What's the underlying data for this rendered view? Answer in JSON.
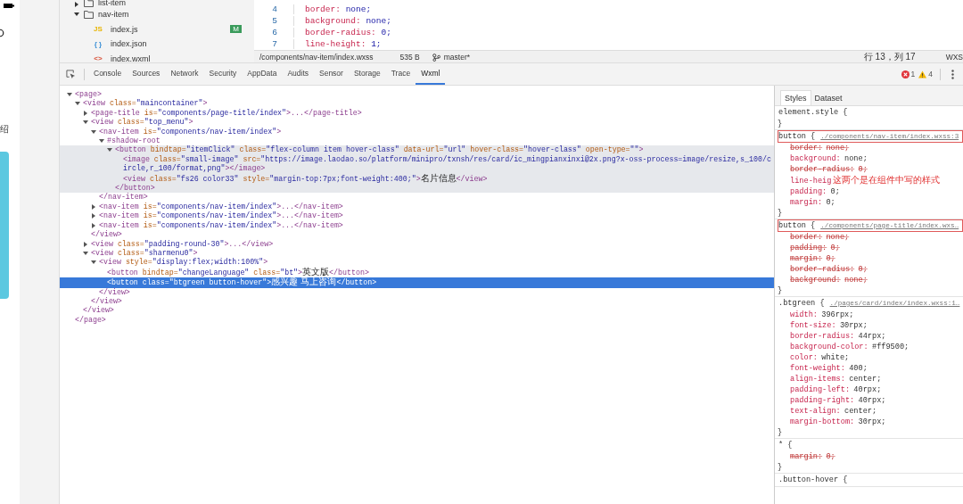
{
  "simulator": {
    "side_text": "绍"
  },
  "file_tree": [
    {
      "name": "list-item",
      "kind": "folder",
      "expanded": false
    },
    {
      "name": "nav-item",
      "kind": "folder",
      "expanded": true,
      "children": [
        {
          "name": "index.js",
          "kind": "js",
          "icon": "JS",
          "badge": "M"
        },
        {
          "name": "index.json",
          "kind": "json",
          "icon": "{ }"
        },
        {
          "name": "index.wxml",
          "kind": "wxml",
          "icon": "<>"
        }
      ]
    }
  ],
  "editor": {
    "lines": [
      {
        "number": "4",
        "prop": "border:",
        "value": "none;"
      },
      {
        "number": "5",
        "prop": "background:",
        "value": "none;"
      },
      {
        "number": "6",
        "prop": "border-radius:",
        "value": "0;"
      },
      {
        "number": "7",
        "prop": "line-height:",
        "value": "1;"
      }
    ]
  },
  "status_bar": {
    "path": "/components/nav-item/index.wxss",
    "size": "535 B",
    "branch": "master*",
    "position": "行 13，列 17",
    "language": "WXS"
  },
  "devtools": {
    "tabs": [
      {
        "label": "Console",
        "selected": false
      },
      {
        "label": "Sources",
        "selected": false
      },
      {
        "label": "Network",
        "selected": false
      },
      {
        "label": "Security",
        "selected": false
      },
      {
        "label": "AppData",
        "selected": false
      },
      {
        "label": "Audits",
        "selected": false
      },
      {
        "label": "Sensor",
        "selected": false
      },
      {
        "label": "Storage",
        "selected": false
      },
      {
        "label": "Trace",
        "selected": false
      },
      {
        "label": "Wxml",
        "selected": true
      }
    ],
    "errors": "1",
    "warnings": "4"
  },
  "wxml": [
    {
      "kind": "branch",
      "tag": "<page",
      "end": ">",
      "expanded": true,
      "selected": false,
      "hovered": false,
      "close": "</page>",
      "children": [
        {
          "kind": "branch",
          "tag": "<view",
          "attrs": [
            {
              "name": "class=",
              "value": "\"maincontainer\""
            }
          ],
          "end": ">",
          "expanded": true,
          "selected": false,
          "hovered": false,
          "close": "</view>",
          "children": [
            {
              "kind": "branch",
              "tag": "<page-title",
              "attrs": [
                {
                  "name": "is=",
                  "value": "\"components/page-title/index\""
                }
              ],
              "end": ">...</page-title>",
              "expanded": false,
              "selected": false,
              "hovered": false
            },
            {
              "kind": "branch",
              "tag": "<view",
              "attrs": [
                {
                  "name": "class=",
                  "value": "\"top_menu\""
                }
              ],
              "end": ">",
              "expanded": true,
              "selected": false,
              "hovered": false,
              "close": "</view>",
              "children": [
                {
                  "kind": "branch",
                  "tag": "<nav-item",
                  "attrs": [
                    {
                      "name": "is=",
                      "value": "\"components/nav-item/index\""
                    }
                  ],
                  "end": ">",
                  "expanded": true,
                  "selected": false,
                  "hovered": false,
                  "close": "</nav-item>",
                  "children": [
                    {
                      "kind": "branch",
                      "tag": "#shadow-root",
                      "expanded": true,
                      "selected": false,
                      "hovered": false,
                      "children": [
                        {
                          "kind": "branch",
                          "tag": "<button",
                          "attrs": [
                            {
                              "name": "bindtap=",
                              "value": "\"itemClick\""
                            },
                            {
                              "name": "class=",
                              "value": "\"flex-column item hover-class\""
                            },
                            {
                              "name": "data-url=",
                              "value": "\"url\""
                            },
                            {
                              "name": "hover-class=",
                              "value": "\"hover-class\""
                            },
                            {
                              "name": "open-type=",
                              "value": "\"\""
                            }
                          ],
                          "end": ">",
                          "expanded": true,
                          "selected": false,
                          "hovered": true,
                          "close": "</button>",
                          "children": [
                            {
                              "kind": "leaf",
                              "tag": "<image",
                              "attrs": [
                                {
                                  "name": "class=",
                                  "value": "\"small-image\""
                                },
                                {
                                  "name": "src=",
                                  "value": "\"https://image.laodao.so/platform/minipro/txnsh/res/card/ic_mingpianxinxi@2x.png?x-oss-process=image/resize,s_100/circle,r_100/format,png\""
                                }
                              ],
                              "end": "></image>",
                              "selected": false,
                              "hovered": true
                            },
                            {
                              "kind": "leaf",
                              "tag": "<view",
                              "attrs": [
                                {
                                  "name": "class=",
                                  "value": "\"fs26 color33\""
                                },
                                {
                                  "name": "style=",
                                  "value": "\"margin-top:7px;font-weight:400;\""
                                }
                              ],
                              "end": ">",
                              "text": "名片信息",
                              "close": "</view>",
                              "selected": false,
                              "hovered": true
                            }
                          ]
                        }
                      ]
                    }
                  ]
                },
                {
                  "kind": "branch",
                  "tag": "<nav-item",
                  "attrs": [
                    {
                      "name": "is=",
                      "value": "\"components/nav-item/index\""
                    }
                  ],
                  "end": ">...</nav-item>",
                  "expanded": false,
                  "selected": false,
                  "hovered": false
                },
                {
                  "kind": "branch",
                  "tag": "<nav-item",
                  "attrs": [
                    {
                      "name": "is=",
                      "value": "\"components/nav-item/index\""
                    }
                  ],
                  "end": ">...</nav-item>",
                  "expanded": false,
                  "selected": false,
                  "hovered": false
                },
                {
                  "kind": "branch",
                  "tag": "<nav-item",
                  "attrs": [
                    {
                      "name": "is=",
                      "value": "\"components/nav-item/index\""
                    }
                  ],
                  "end": ">...</nav-item>",
                  "expanded": false,
                  "selected": false,
                  "hovered": false
                }
              ]
            },
            {
              "kind": "branch",
              "tag": "<view",
              "attrs": [
                {
                  "name": "class=",
                  "value": "\"padding-round-30\""
                }
              ],
              "end": ">...</view>",
              "expanded": false,
              "selected": false,
              "hovered": false
            },
            {
              "kind": "branch",
              "tag": "<view",
              "attrs": [
                {
                  "name": "class=",
                  "value": "\"sharmenu0\""
                }
              ],
              "end": ">",
              "expanded": true,
              "selected": false,
              "hovered": false,
              "close": "</view>",
              "children": [
                {
                  "kind": "branch",
                  "tag": "<view",
                  "attrs": [
                    {
                      "name": "style=",
                      "value": "\"display:flex;width:100%\""
                    }
                  ],
                  "end": ">",
                  "expanded": true,
                  "selected": false,
                  "hovered": false,
                  "close": "</view>",
                  "children": [
                    {
                      "kind": "leaf",
                      "tag": "<button",
                      "attrs": [
                        {
                          "name": "bindtap=",
                          "value": "\"changeLanguage\""
                        },
                        {
                          "name": "class=",
                          "value": "\"bt\""
                        }
                      ],
                      "end": ">",
                      "text": "英文版",
                      "close": "</button>",
                      "selected": false,
                      "hovered": false
                    },
                    {
                      "kind": "leaf",
                      "tag": "<button",
                      "attrs": [
                        {
                          "name": "class=",
                          "value": "\"btgreen button-hover\""
                        }
                      ],
                      "end": ">",
                      "text": "感兴趣 马上咨询",
                      "close": "</button>",
                      "selected": true,
                      "hovered": false
                    }
                  ]
                }
              ]
            }
          ]
        }
      ]
    }
  ],
  "styles": {
    "tabs": [
      {
        "label": "Styles",
        "selected": true
      },
      {
        "label": "Dataset",
        "selected": false
      }
    ],
    "rules": [
      {
        "selector": "element.style {",
        "close": "}",
        "boxed": false
      },
      {
        "selector": "button {",
        "source": "./components/nav-item/index.wxss:3",
        "boxed": true,
        "close": "}",
        "declarations": [
          {
            "prop": "border:",
            "value": "none;",
            "struck": true
          },
          {
            "prop": "background:",
            "value": "none;",
            "struck": false
          },
          {
            "prop": "border-radius:",
            "value": "0;",
            "struck": true
          },
          {
            "prop": "line-heig",
            "note": "这两个是在组件中写的样式",
            "struck": false
          },
          {
            "prop": "padding:",
            "value": "0;",
            "struck": false
          },
          {
            "prop": "margin:",
            "value": "0;",
            "struck": false
          }
        ]
      },
      {
        "selector": "button {",
        "source": "./components/page-title/index.wxs…",
        "boxed": true,
        "close": "}",
        "declarations": [
          {
            "prop": "border:",
            "value": "none;",
            "struck": true
          },
          {
            "prop": "padding:",
            "value": "0;",
            "struck": true
          },
          {
            "prop": "margin:",
            "value": "0;",
            "struck": true
          },
          {
            "prop": "border-radius:",
            "value": "0;",
            "struck": true
          },
          {
            "prop": "background:",
            "value": "none;",
            "struck": true
          }
        ]
      },
      {
        "selector": ".btgreen {",
        "source": "./pages/card/index/index.wxss:1…",
        "boxed": false,
        "close": "}",
        "declarations": [
          {
            "prop": "width:",
            "value": "396rpx;",
            "struck": false
          },
          {
            "prop": "font-size:",
            "value": "30rpx;",
            "struck": false
          },
          {
            "prop": "border-radius:",
            "value": "44rpx;",
            "struck": false
          },
          {
            "prop": "background-color:",
            "value": "#ff9500;",
            "struck": false
          },
          {
            "prop": "color:",
            "value": "white;",
            "struck": false
          },
          {
            "prop": "font-weight:",
            "value": "400;",
            "struck": false
          },
          {
            "prop": "align-items:",
            "value": "center;",
            "struck": false
          },
          {
            "prop": "padding-left:",
            "value": "40rpx;",
            "struck": false
          },
          {
            "prop": "padding-right:",
            "value": "40rpx;",
            "struck": false
          },
          {
            "prop": "text-align:",
            "value": "center;",
            "struck": false
          },
          {
            "prop": "margin-bottom:",
            "value": "30rpx;",
            "struck": false
          }
        ]
      },
      {
        "selector": "* {",
        "boxed": false,
        "close": "}",
        "declarations": [
          {
            "prop": "margin:",
            "value": "0;",
            "struck": true
          }
        ]
      },
      {
        "selector": ".button-hover {",
        "boxed": false
      }
    ]
  }
}
